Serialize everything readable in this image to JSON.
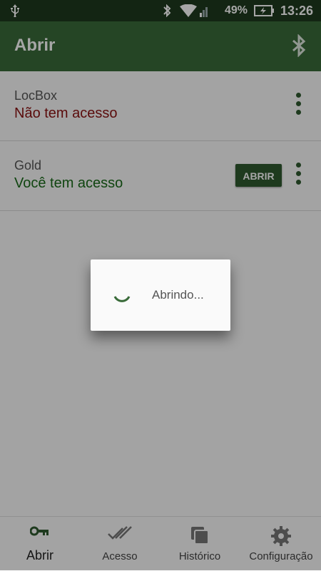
{
  "status_bar": {
    "battery_percent": "49%",
    "time": "13:26",
    "icons": [
      "usb-icon",
      "bluetooth-icon",
      "wifi-icon",
      "signal-icon",
      "battery-charging-icon"
    ]
  },
  "app_bar": {
    "title": "Abrir",
    "action_icon": "bluetooth-icon"
  },
  "locks": [
    {
      "name": "LocBox",
      "access": "Não tem acesso"
    },
    {
      "name": "Gold",
      "access": "Você tem acesso",
      "open_label": "ABRIR"
    }
  ],
  "dialog": {
    "message": "Abrindo..."
  },
  "bottom_nav": [
    {
      "label": "Abrir",
      "icon": "key-icon",
      "active": true
    },
    {
      "label": "Acesso",
      "icon": "double-check-icon"
    },
    {
      "label": "Histórico",
      "icon": "history-stack-icon"
    },
    {
      "label": "Configuração",
      "icon": "gear-icon"
    }
  ],
  "colors": {
    "primary": "#3a6b3a",
    "status_bar": "#1e3a1e",
    "no_access": "#8b1111",
    "has_access": "#1a6b1a"
  }
}
